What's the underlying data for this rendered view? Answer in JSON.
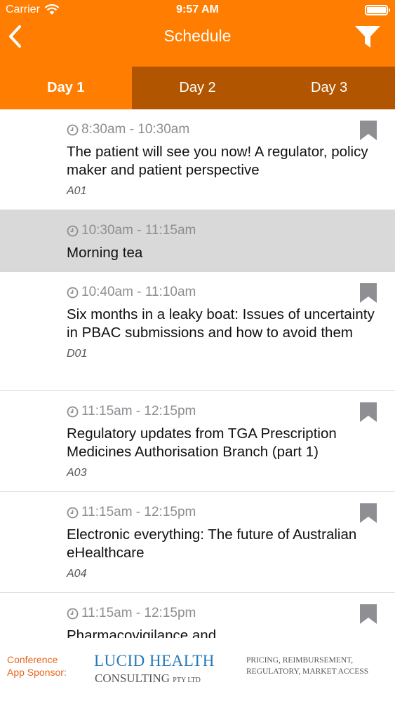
{
  "status_bar": {
    "carrier": "Carrier",
    "time": "9:57 AM"
  },
  "nav": {
    "title": "Schedule"
  },
  "tabs": [
    {
      "label": "Day 1",
      "active": true
    },
    {
      "label": "Day 2",
      "active": false
    },
    {
      "label": "Day 3",
      "active": false
    }
  ],
  "sessions": [
    {
      "time": "8:30am - 10:30am",
      "title": "The patient will see you now!  A regulator, policy maker and patient perspective",
      "code": "A01",
      "bookmarkable": true
    },
    {
      "time": "10:30am - 11:15am",
      "title": "Morning tea",
      "code": "",
      "bookmarkable": false
    },
    {
      "time": "10:40am - 11:10am",
      "title": "Six months in a leaky boat: Issues of uncertainty in PBAC submissions and how to avoid them",
      "code": "D01",
      "bookmarkable": true
    },
    {
      "time": "11:15am - 12:15pm",
      "title": "Regulatory updates from TGA Prescription Medicines Authorisation Branch (part 1)",
      "code": "A03",
      "bookmarkable": true
    },
    {
      "time": "11:15am - 12:15pm",
      "title": "Electronic everything: The future of Australian eHealthcare",
      "code": "A04",
      "bookmarkable": true
    },
    {
      "time": "11:15am - 12:15pm",
      "title": "Pharmacovigilance and",
      "code": "",
      "bookmarkable": true
    }
  ],
  "sponsor": {
    "label_line1": "Conference",
    "label_line2": "App Sponsor:",
    "logo_line1": "LUCID HEALTH",
    "logo_line2": "CONSULTING",
    "logo_suffix": "PTY LTD",
    "tagline_line1": "PRICING, REIMBURSEMENT,",
    "tagline_line2": "REGULATORY, MARKET ACCESS"
  },
  "colors": {
    "accent": "#ff7d00",
    "tab_inactive": "#b25500",
    "break_bg": "#d9d9d9",
    "sponsor_text": "#e9641f",
    "logo_blue": "#2478b8"
  },
  "icons": {
    "back": "chevron-left-icon",
    "filter": "filter-icon",
    "time": "clock-icon",
    "bookmark": "bookmark-icon"
  }
}
